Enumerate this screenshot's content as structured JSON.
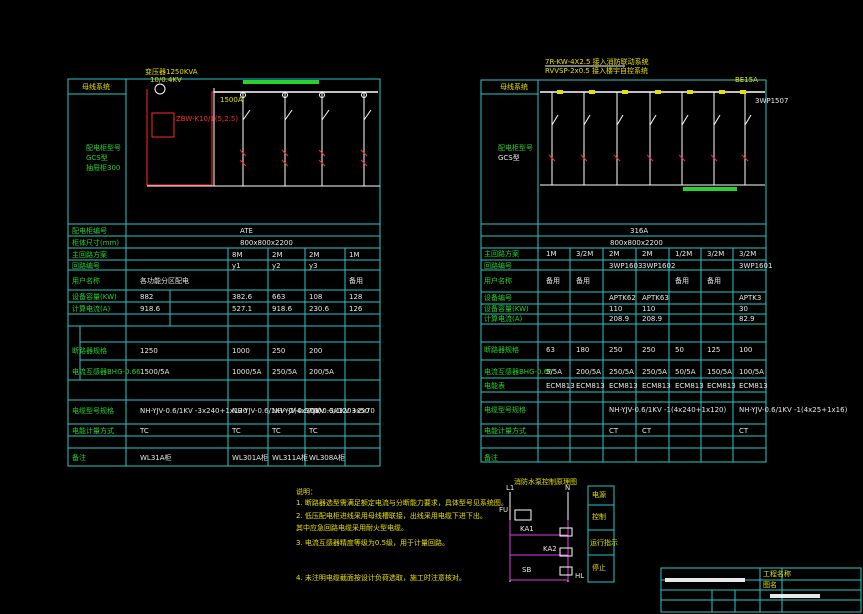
{
  "left_panel": {
    "header_label": "母线系统",
    "side_title": "配电柜型号",
    "side_line2": "GCS型",
    "side_line3": "抽屉柜300",
    "source_note1": "变压器1250KVA",
    "source_note2": "10/0.4KV",
    "transformer_note": "ZBW-K10/1(5,2.5)",
    "breaker_rating": "1500A",
    "cabinet_no": "ATE",
    "dimensions": "800x800x2200",
    "rows": [
      {
        "label": "配电柜编号",
        "cells": [
          "ATE",
          "",
          "",
          ""
        ]
      },
      {
        "label": "柜体尺寸(mm)",
        "cells": [
          "800x800x2200",
          "",
          "",
          ""
        ]
      },
      {
        "label": "主回路方案",
        "cells": [
          "",
          "8M",
          "2M",
          "2M",
          "1M"
        ]
      },
      {
        "label": "回路编号",
        "cells": [
          "",
          "y1",
          "y2",
          "y3",
          ""
        ]
      },
      {
        "label": "用户名称",
        "cells": [
          "各功能分区配电",
          "",
          "",
          "",
          "备用"
        ]
      },
      {
        "label": "设备容量(KW)",
        "cells": [
          "882",
          "382.6",
          "663",
          "108",
          "128"
        ]
      },
      {
        "label": "计算电流(A)",
        "cells": [
          "918.6",
          "527.1",
          "918.6",
          "230.6",
          "126"
        ]
      },
      {
        "label": "断路器规格",
        "cells": [
          "1250",
          "1000",
          "250",
          "200"
        ]
      },
      {
        "label": "电流互感器BHG-0.66",
        "cells": [
          "1500/5A",
          "1000/5A",
          "250/5A",
          "200/5A"
        ]
      },
      {
        "label": "电缆型号规格",
        "cells": [
          "NH-YJV-0.6/1KV -3x240+1x120",
          "NH-YJV-0.6/1KV -2(4x300)",
          "NH-YJV-0.6/1KV -3x120+2x70",
          "YJV-0.6/1KV 3x50"
        ]
      },
      {
        "label": "电能计量方式",
        "cells": [
          "TC",
          "TC",
          "TC",
          "TC"
        ]
      },
      {
        "label": "备注",
        "cells": [
          "WL31A柜",
          "WL301A柜",
          "WL311A柜",
          "WL308A柜"
        ]
      }
    ]
  },
  "right_panel": {
    "header_label": "母线系统",
    "side_title": "配电柜型号",
    "side_line2": "GCS型",
    "incoming_note1": "7R-KW-4X2.5 接入消防联动系统",
    "incoming_note2": "RVVSP-2x0.5 接入楼宇自控系统",
    "busbar_label": "BE15A",
    "breaker_label": "3WP1507",
    "cabinet_no": "316A",
    "dimensions": "800x800x2200",
    "rows": [
      {
        "label": "主回路方案",
        "cells": [
          "1M",
          "3/2M",
          "2M",
          "2M",
          "1/2M",
          "3/2M",
          "3/2M"
        ]
      },
      {
        "label": "回路编号",
        "cells": [
          "",
          "",
          "3WP1603",
          "3WP1602",
          "",
          "",
          "3WP1601"
        ]
      },
      {
        "label": "用户名称",
        "cells": [
          "备用",
          "备用",
          "",
          "",
          "备用",
          "备用",
          ""
        ]
      },
      {
        "label": "设备编号",
        "cells": [
          "",
          "",
          "APTK62",
          "APTK63",
          "",
          "",
          "APTK3"
        ]
      },
      {
        "label": "设备容量(KW)",
        "cells": [
          "",
          "",
          "110",
          "110",
          "",
          "",
          "30"
        ]
      },
      {
        "label": "计算电流(A)",
        "cells": [
          "",
          "",
          "208.9",
          "208.9",
          "",
          "",
          "82.9"
        ]
      },
      {
        "label": "断路器规格",
        "cells": [
          "63",
          "180",
          "250",
          "250",
          "50",
          "125",
          "100"
        ]
      },
      {
        "label": "电流互感器BHG-0.66",
        "cells": [
          "5/5A",
          "200/5A",
          "250/5A",
          "250/5A",
          "50/5A",
          "150/5A",
          "100/5A"
        ]
      },
      {
        "label": "电能表",
        "cells": [
          "ECM813",
          "ECM813",
          "ECM813",
          "ECM813",
          "ECM813",
          "ECM813",
          "ECM813"
        ]
      },
      {
        "label": "电缆型号规格",
        "cells": [
          "",
          "",
          "NH-YJV-0.6/1KV -1(4x240+1x120)",
          "",
          "",
          "",
          "NH-YJV-0.6/1KV -1(4x25+1x16)"
        ]
      },
      {
        "label": "电能计量方式",
        "cells": [
          "",
          "",
          "CT",
          "CT",
          "",
          "",
          "CT"
        ]
      },
      {
        "label": "备注",
        "cells": [
          "",
          "",
          "",
          "",
          "",
          "",
          ""
        ]
      }
    ]
  },
  "notes": {
    "title": "说明：",
    "lines": [
      "1. 断路器选型需满足额定电流与分断能力要求，具体型号见系统图。",
      "2. 低压配电柜进线采用母线槽联接，出线采用电缆下进下出。",
      "   其中应急回路电缆采用耐火型电缆。",
      "3. 电流互感器精度等级为0.5级，用于计量回路。",
      "4. 未注明电缆截面按设计负荷选取，施工时注意核对。"
    ]
  },
  "control_diagram": {
    "title": "消防水泵控制原理图",
    "labels": [
      "L1",
      "N",
      "FU",
      "KA1",
      "KA2",
      "SB",
      "HL"
    ],
    "side_boxes": [
      "电源",
      "控制",
      "运行指示",
      "停止"
    ]
  },
  "title_block": {
    "project_label": "工程名称",
    "drawing_label": "图名"
  }
}
